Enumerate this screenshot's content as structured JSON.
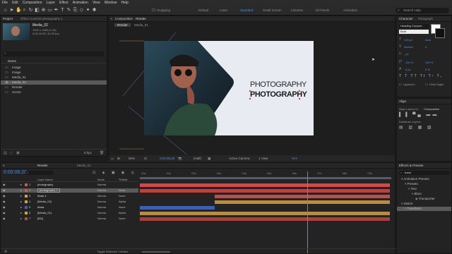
{
  "menu": [
    "File",
    "Edit",
    "Composition",
    "Layer",
    "Effect",
    "Animation",
    "View",
    "Window",
    "Help"
  ],
  "workspaces": [
    {
      "label": "Snapping",
      "active": false
    },
    {
      "label": "Default",
      "active": false
    },
    {
      "label": "Learn",
      "active": false
    },
    {
      "label": "Standard",
      "active": true
    },
    {
      "label": "Small Screen",
      "active": false
    },
    {
      "label": "Libraries",
      "active": false
    },
    {
      "label": "All Panels",
      "active": false
    },
    {
      "label": "Animation",
      "active": false
    }
  ],
  "search_help": "Search Help",
  "project": {
    "tab": "Project",
    "effect_controls": "Effect Controls photography 1",
    "item_name": "Media_02",
    "item_meta1": "1920 x 1080 (1.00)",
    "item_meta2": "0;00;10;00, 30.00 fps",
    "col_name": "Name",
    "items": [
      {
        "label": "Image",
        "selected": false
      },
      {
        "label": "Image",
        "selected": false
      },
      {
        "label": "Media_01",
        "selected": false
      },
      {
        "label": "Media_02",
        "selected": true
      },
      {
        "label": "Render",
        "selected": false
      },
      {
        "label": "Scene",
        "selected": false
      }
    ],
    "bpc": "8 bpc"
  },
  "composition": {
    "tab": "Composition",
    "tab_name": "Render",
    "crumbs": [
      "Render",
      "Media_01"
    ],
    "headline1": "PHOTOGRAPHY",
    "headline2": "PHOTOGRAPHY",
    "zoom": "50%",
    "timecode": "0;00;06;20",
    "resolution": "(Half)",
    "camera": "Active Camera",
    "views": "1 View",
    "offset": "+0.0"
  },
  "character": {
    "tab": "Character",
    "tab2": "Paragraph",
    "font": "Heading Compre...",
    "style": "Bold",
    "size": "146 px",
    "leading": "Auto",
    "kerning": "Metrics",
    "tracking": "0",
    "stroke": "- px",
    "vscale": "100 %",
    "hscale": "100 %",
    "baseline": "0 px",
    "tsume": "0 %",
    "ligatures": "Ligatures",
    "hindi": "Hindi Digits"
  },
  "align": {
    "tab": "Align",
    "align_to_label": "Align Layers to:",
    "align_to_value": "Composition",
    "distribute": "Distribute Layers:"
  },
  "timeline": {
    "tab": "Render",
    "tab2": "Media_01",
    "timecode": "0:00:06:20",
    "col_layer": "Layer Name",
    "col_mode": "Mode",
    "col_trkmat": "TrkMat",
    "ticks": [
      "00s",
      "01s",
      "02s",
      "03s",
      "04s",
      "05s",
      "06s",
      "07s",
      "08s",
      "09s"
    ],
    "footer": "Toggle Switches / Modes",
    "layers": [
      {
        "num": "1",
        "name": "photography",
        "mode": "Norma",
        "trk": "",
        "color": "#e05050",
        "bar": "#d04848",
        "start": 0,
        "end": 1,
        "selected": false
      },
      {
        "num": "2",
        "name": "photography 1",
        "mode": "Norma",
        "trk": "None",
        "color": "#e05050",
        "bar": "#c83c3c",
        "start": 0,
        "end": 1,
        "selected": true
      },
      {
        "num": "3",
        "name": "Mask 1",
        "mode": "Norma",
        "trk": "None",
        "color": "#d9a038",
        "bar": "#b55050",
        "start": 0.3,
        "end": 1,
        "selected": false
      },
      {
        "num": "4",
        "name": "[Media_02]",
        "mode": "Norma",
        "trk": "Alpha",
        "color": "#d9a038",
        "bar": "#c08a3c",
        "start": 0.3,
        "end": 1,
        "selected": false
      },
      {
        "num": "5",
        "name": "Mask",
        "mode": "Norma",
        "trk": "None",
        "color": "#3a5ec0",
        "bar": "#3d5fb8",
        "start": 0,
        "end": 0.3,
        "selected": false
      },
      {
        "num": "6",
        "name": "[Media_01]",
        "mode": "Norma",
        "trk": "Alpha",
        "color": "#d9a038",
        "bar": "#b88c48",
        "start": 0,
        "end": 1,
        "selected": false
      },
      {
        "num": "7",
        "name": "[BG]",
        "mode": "Norma",
        "trk": "None",
        "color": "#c04848",
        "bar": "#a94040",
        "start": 0,
        "end": 1,
        "selected": false
      }
    ],
    "playhead_fraction": 0.67
  },
  "effects": {
    "tab": "Effects & Presets",
    "search": "trans",
    "tree": [
      {
        "label": "Animation Presets",
        "indent": 0
      },
      {
        "label": "Presets",
        "indent": 1
      },
      {
        "label": "Text",
        "indent": 2
      },
      {
        "label": "Blurs",
        "indent": 3
      },
      {
        "label": "Transporter",
        "indent": 4
      },
      {
        "label": "Distort",
        "indent": 0
      },
      {
        "label": "Transform",
        "indent": 1
      }
    ]
  },
  "colors": {
    "accent": "#4d8fe6",
    "panel": "#232323",
    "bg": "#1d1d1d",
    "highlight": "#e0e0e0"
  }
}
